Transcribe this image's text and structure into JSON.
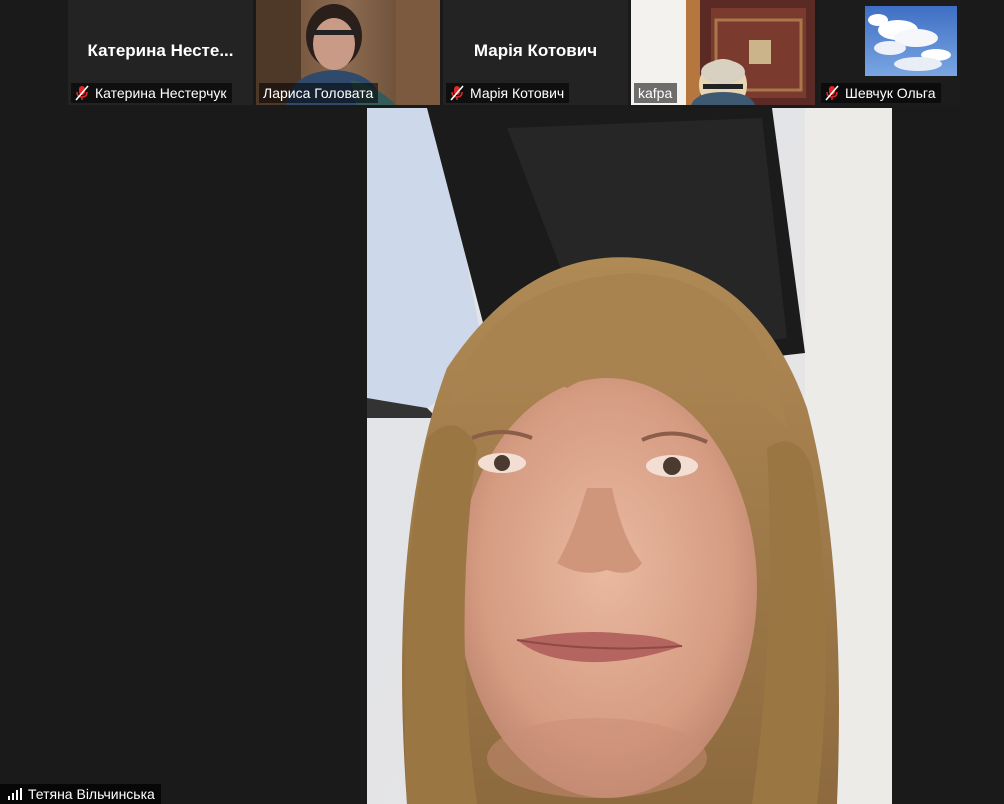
{
  "participants": [
    {
      "name": "Катерина Нестерчук",
      "display_name": "Катерина  Несте...",
      "muted": true,
      "video": false
    },
    {
      "name": "Лариса Головата",
      "muted": false,
      "video": true
    },
    {
      "name": "Марія Котович",
      "display_name": "Марія Котович",
      "muted": true,
      "video": false
    },
    {
      "name": "kafpa",
      "muted": false,
      "video": true
    },
    {
      "name": "Шевчук Ольга",
      "muted": true,
      "video": true
    }
  ],
  "active_speaker": {
    "name": "Тетяна Вільчинська"
  },
  "icons": {
    "muted": "mic-off-icon",
    "signal": "signal-bars-icon"
  },
  "colors": {
    "background": "#1a1a1a",
    "muted_icon": "#e02828",
    "label_text": "#ffffff"
  }
}
